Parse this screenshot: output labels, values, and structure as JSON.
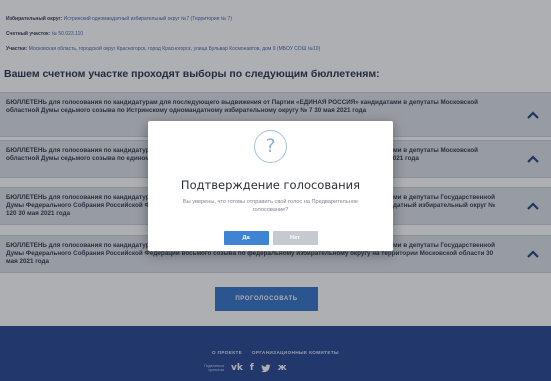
{
  "info": {
    "district_label": "Избирательный округ:",
    "district_value": "Истринский одномандатный избирательный округ №7 (Территория № 7)",
    "precinct_label": "Счетный участок:",
    "precinct_value": "№ 50.023.110",
    "area_label": "Участки:",
    "area_value": "Московская область, городской округ Красногорск, город Красногорск, улица Бульвар Космонавтов, дом 9 (МБОУ СОШ №10)"
  },
  "heading": "Вашем счетном участке проходят выборы по следующим бюллетеням:",
  "ballots": [
    {
      "text": "БЮЛЛЕТЕНЬ для голосования по кандидатурам для последующего выдвижения от Партии «ЕДИНАЯ РОССИЯ» кандидатами в депутаты Московской областной Думы седьмого созыва по Истринскому одномандатному избирательному округу № 7 30 мая 2021 года"
    },
    {
      "text": "БЮЛЛЕТЕНЬ для голосования по кандидатурам для последующего выдвижения от Партии «ЕДИНАЯ РОССИЯ» кандидатами в депутаты Московской областной Думы седьмого созыва по единому избирательному округу (территориальная группа № 7 Истринская) 30 мая 2021 года"
    },
    {
      "text": "БЮЛЛЕТЕНЬ для голосования по кандидатурам для последующего выдвижения от Партии «ЕДИНАЯ РОССИЯ» кандидатами в депутаты Государственной Думы Федерального Собрания Российской Федерации восьмого созыва по Московская область - Красногорский одномандатный избирательный округ № 120 30 мая 2021 года"
    },
    {
      "text": "БЮЛЛЕТЕНЬ для голосования по кандидатурам для последующего выдвижения от Партии «ЕДИНАЯ РОССИЯ» кандидатами в депутаты Государственной Думы Федерального Собрания Российской Федерации восьмого созыва по федеральному избирательному округу на территории Московской области 30 мая 2021 года"
    }
  ],
  "vote_button": "ПРОГОЛОСОВАТЬ",
  "footer": {
    "about_link": "О ПРОЕКТЕ",
    "committees_link": "ОРГАНИЗАЦИОННЫЕ КОМИТЕТЫ",
    "share_text": "Поделиться проектом",
    "socials": [
      {
        "icon": "vk-icon",
        "glyph": "ᴡᴋ"
      },
      {
        "icon": "facebook-icon",
        "glyph": "f"
      },
      {
        "icon": "twitter-icon",
        "glyph": "🐦"
      },
      {
        "icon": "odnoklassniki-icon",
        "glyph": "Ж"
      }
    ]
  },
  "modal": {
    "icon": "question-icon",
    "icon_glyph": "?",
    "title": "Подтверждение голосования",
    "text": "Вы уверены, что готовы отправить свой голос на Предварительное голосование?",
    "yes_label": "Да",
    "no_label": "Нет"
  },
  "colors": {
    "primary_button": "#2d6fc7",
    "footer_bg": "#1f3f8f",
    "ballot_bg": "#dcdfe5",
    "modal_yes": "#3f83d4",
    "modal_no": "#c5c9d0"
  }
}
